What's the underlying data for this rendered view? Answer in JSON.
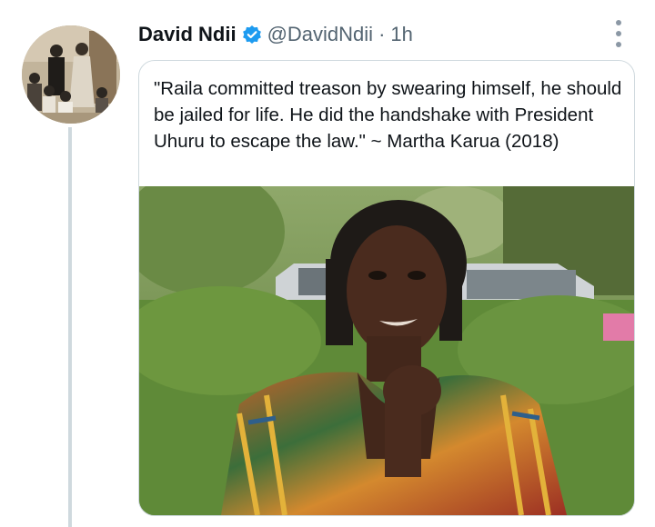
{
  "tweet": {
    "author_name": "David Ndii",
    "handle": "@DavidNdii",
    "separator": "·",
    "time": "1h",
    "verified": true,
    "quote_text": "\"Raila committed treason by swearing himself, he should be jailed for life. He did the handshake with President Uhuru to escape the law.\" ~ Martha Karua (2018)"
  },
  "icons": {
    "verified": "verified-badge-icon",
    "more": "more-options-icon"
  },
  "colors": {
    "accent": "#1d9bf0",
    "text": "#0f1419",
    "muted": "#536471",
    "border": "#cfd9de"
  }
}
